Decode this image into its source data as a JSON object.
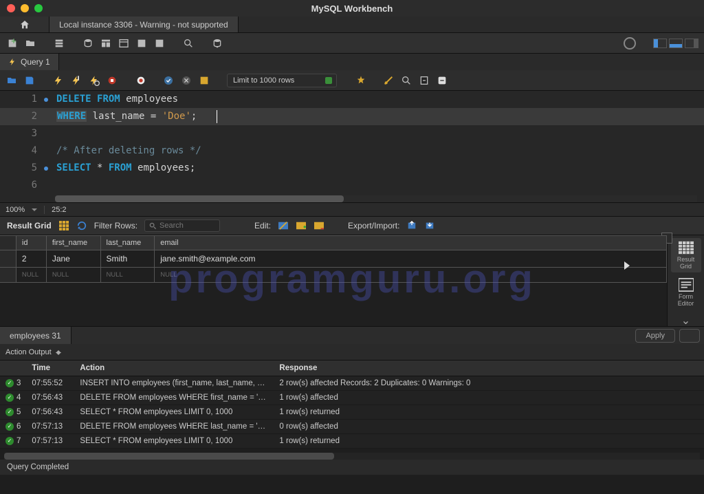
{
  "window": {
    "title": "MySQL Workbench"
  },
  "connection_tab": "Local instance 3306 - Warning - not supported",
  "query_tab": "Query 1",
  "limit_label": "Limit to 1000 rows",
  "editor": {
    "lines": [
      {
        "n": "1",
        "dot": true
      },
      {
        "n": "2",
        "dot": false
      },
      {
        "n": "3",
        "dot": false
      },
      {
        "n": "4",
        "dot": false
      },
      {
        "n": "5",
        "dot": true
      },
      {
        "n": "6",
        "dot": false
      }
    ],
    "l1_kw1": "DELETE",
    "l1_kw2": "FROM",
    "l1_id": "employees",
    "l2_kw": "WHERE",
    "l2_id": "last_name",
    "l2_op": " = ",
    "l2_str": "'Doe'",
    "l2_semi": ";",
    "l4_cmt": "/* After deleting rows */",
    "l5_kw1": "SELECT",
    "l5_star": " * ",
    "l5_kw2": "FROM",
    "l5_id": "employees",
    "l5_semi": ";",
    "zoom": "100%",
    "pos": "25:2"
  },
  "result_toolbar": {
    "title": "Result Grid",
    "filter_label": "Filter Rows:",
    "search_placeholder": "Search",
    "edit_label": "Edit:",
    "export_label": "Export/Import:"
  },
  "result": {
    "columns": {
      "c0": "id",
      "c1": "first_name",
      "c2": "last_name",
      "c3": "email"
    },
    "row": {
      "c0": "2",
      "c1": "Jane",
      "c2": "Smith",
      "c3": "jane.smith@example.com"
    },
    "null_label": "NULL"
  },
  "side": {
    "grid": "Result\nGrid",
    "form": "Form\nEditor"
  },
  "result_tab": "employees 31",
  "apply_label": "Apply",
  "action_output": {
    "title": "Action Output",
    "headers": {
      "h0": "",
      "h1": "Time",
      "h2": "Action",
      "h3": "Response"
    },
    "rows": [
      {
        "idx": "3",
        "time": "07:55:52",
        "action": "INSERT INTO employees (first_name, last_name, em…",
        "resp": "2 row(s) affected Records: 2  Duplicates: 0  Warnings: 0"
      },
      {
        "idx": "4",
        "time": "07:56:43",
        "action": "DELETE FROM employees WHERE first_name = 'Joh…",
        "resp": "1 row(s) affected"
      },
      {
        "idx": "5",
        "time": "07:56:43",
        "action": "SELECT * FROM employees LIMIT 0, 1000",
        "resp": "1 row(s) returned"
      },
      {
        "idx": "6",
        "time": "07:57:13",
        "action": "DELETE FROM employees WHERE last_name = 'Doe'",
        "resp": "0 row(s) affected"
      },
      {
        "idx": "7",
        "time": "07:57:13",
        "action": "SELECT * FROM employees LIMIT 0, 1000",
        "resp": "1 row(s) returned"
      }
    ]
  },
  "statusbar": "Query Completed",
  "watermark": "programguru.org"
}
